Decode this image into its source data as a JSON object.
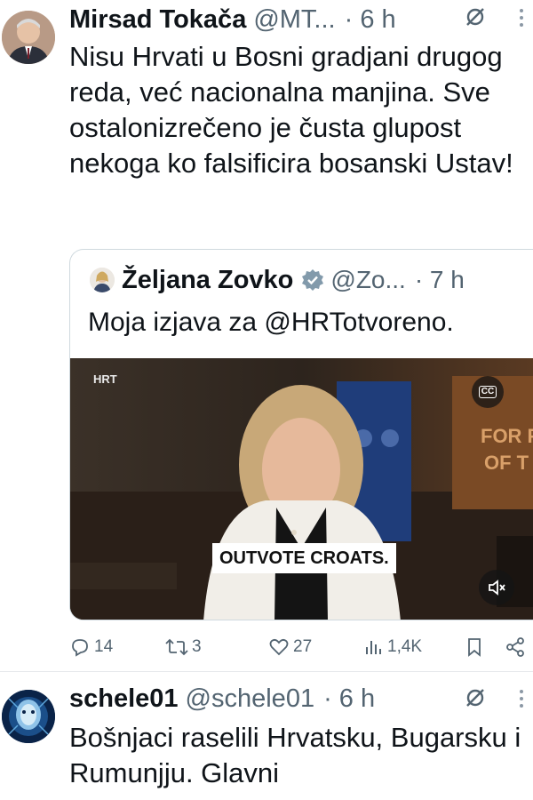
{
  "tweet1": {
    "name": "Mirsad Tokača",
    "handle": "@MT...",
    "time": "· 6 h",
    "text": "Nisu Hrvati u Bosni gradjani drugog reda, već nacionalna manjina. Sve ostalonizrečeno je čusta glupost nekoga ko falsificira bosanski Ustav!",
    "quote": {
      "name": "Željana Zovko",
      "handle": "@Zo...",
      "time": "· 7 h",
      "text": "Moja izjava za @HRTotvoreno.",
      "video": {
        "caption": "OUTVOTE CROATS.",
        "channel_logo": "HRT",
        "cc_label": "CC"
      }
    },
    "actions": {
      "replies": "14",
      "reposts": "3",
      "likes": "27",
      "views": "1,4K"
    }
  },
  "tweet2": {
    "name": "schele01",
    "handle": "@schele01",
    "time": "· 6 h",
    "text": "Bošnjaci raselili Hrvatsku, Bugarsku i Rumunjju. Glavni"
  },
  "icons": {
    "reply": "reply-icon",
    "repost": "repost-icon",
    "like": "heart-icon",
    "views": "views-icon",
    "bookmark": "bookmark-icon",
    "share": "share-icon",
    "grok": "grok-icon",
    "more": "more-icon",
    "verified": "verified-badge-icon",
    "captions": "captions-icon",
    "mute": "mute-icon"
  },
  "colors": {
    "text": "#0f1419",
    "secondary": "#536471",
    "border": "#cfd9de"
  }
}
